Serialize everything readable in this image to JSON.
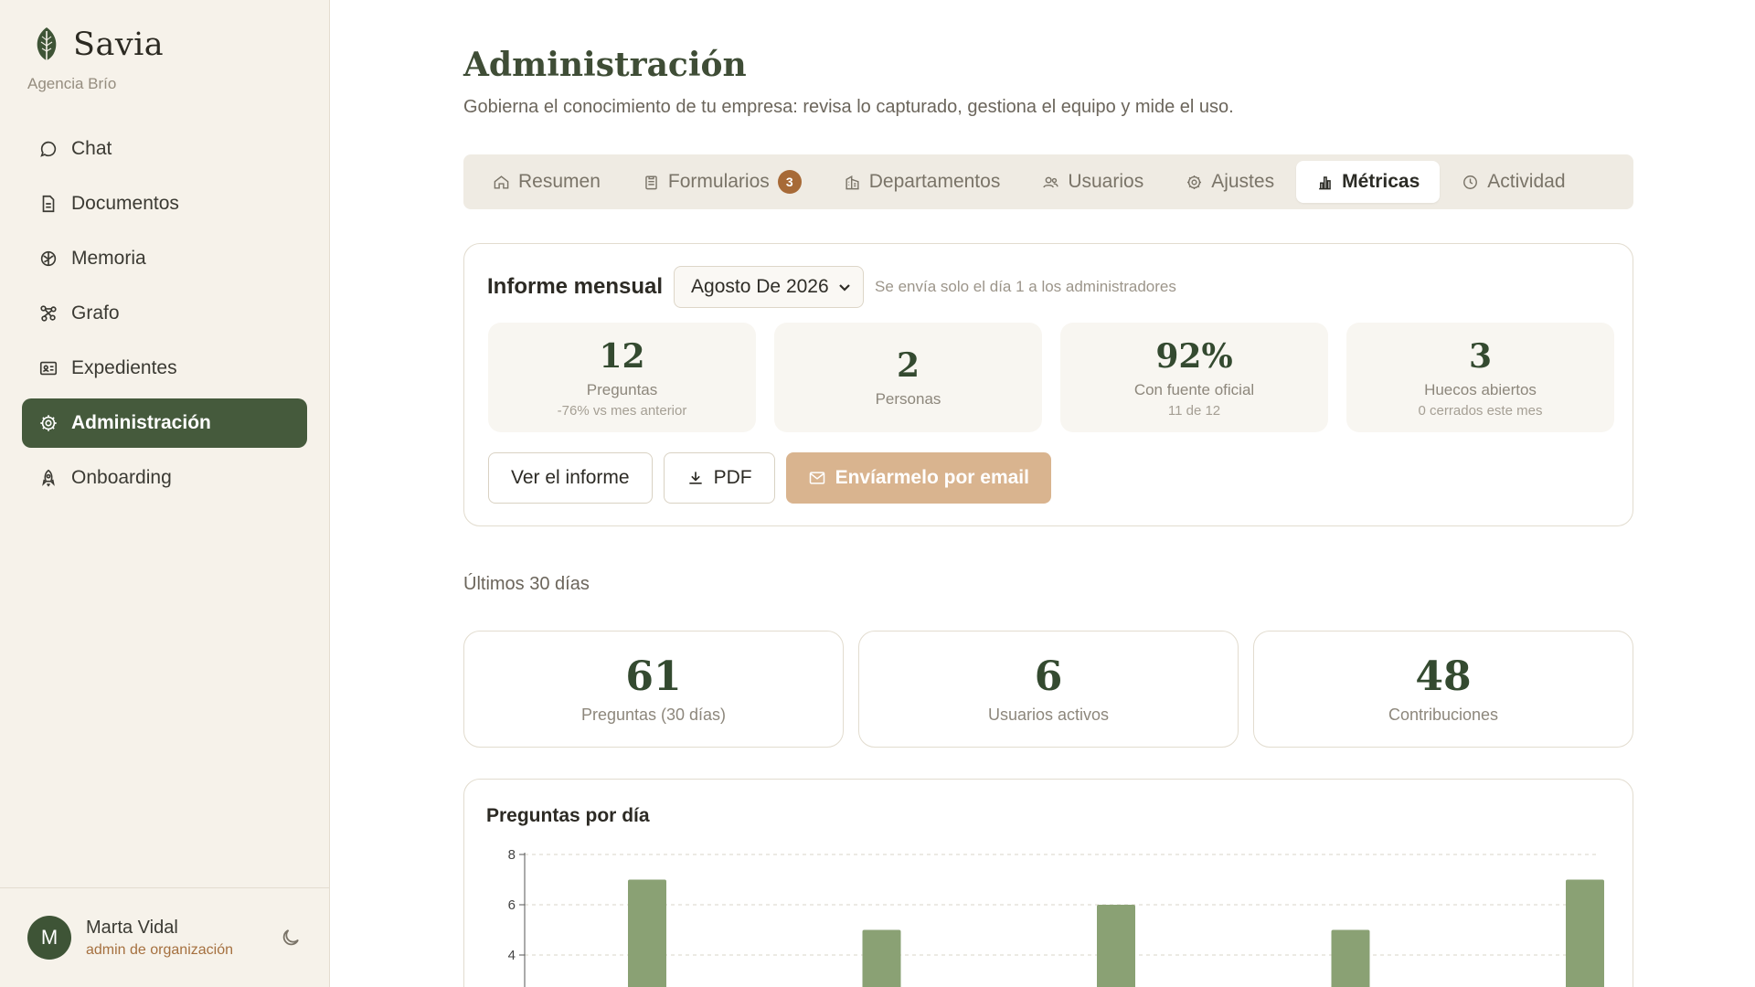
{
  "sidebar": {
    "brand": "Savia",
    "org": "Agencia Brío",
    "items": [
      {
        "label": "Chat",
        "icon": "chat-icon"
      },
      {
        "label": "Documentos",
        "icon": "document-icon"
      },
      {
        "label": "Memoria",
        "icon": "brain-icon"
      },
      {
        "label": "Grafo",
        "icon": "graph-icon"
      },
      {
        "label": "Expedientes",
        "icon": "id-card-icon"
      },
      {
        "label": "Administración",
        "icon": "gear-icon",
        "active": true
      },
      {
        "label": "Onboarding",
        "icon": "rocket-icon"
      }
    ],
    "user": {
      "initial": "M",
      "name": "Marta Vidal",
      "role": "admin de organización"
    }
  },
  "header": {
    "title": "Administración",
    "subtitle": "Gobierna el conocimiento de tu empresa: revisa lo capturado, gestiona el equipo y mide el uso."
  },
  "tabs": [
    {
      "label": "Resumen",
      "icon": "home-icon"
    },
    {
      "label": "Formularios",
      "icon": "clipboard-icon",
      "badge": "3"
    },
    {
      "label": "Departamentos",
      "icon": "building-icon"
    },
    {
      "label": "Usuarios",
      "icon": "users-icon"
    },
    {
      "label": "Ajustes",
      "icon": "gear-icon"
    },
    {
      "label": "Métricas",
      "icon": "bar-chart-icon",
      "active": true
    },
    {
      "label": "Actividad",
      "icon": "clock-icon"
    }
  ],
  "report": {
    "title": "Informe mensual",
    "month": "Agosto De 2026",
    "note": "Se envía solo el día 1 a los administradores",
    "stats": [
      {
        "value": "12",
        "label": "Preguntas",
        "sub": "-76% vs mes anterior"
      },
      {
        "value": "2",
        "label": "Personas",
        "sub": ""
      },
      {
        "value": "92%",
        "label": "Con fuente oficial",
        "sub": "11 de 12"
      },
      {
        "value": "3",
        "label": "Huecos abiertos",
        "sub": "0 cerrados este mes"
      }
    ],
    "view_label": "Ver el informe",
    "pdf_label": "PDF",
    "email_label": "Envíarmelo por email"
  },
  "period": {
    "label": "Últimos 30 días",
    "kpis": [
      {
        "value": "61",
        "label": "Preguntas (30 días)"
      },
      {
        "value": "6",
        "label": "Usuarios activos"
      },
      {
        "value": "48",
        "label": "Contribuciones"
      }
    ]
  },
  "colors": {
    "accent": "#455a3c",
    "bar": "#8aa174",
    "badge": "#a76a37",
    "email_button": "#d9b48f"
  },
  "chart_data": {
    "type": "bar",
    "title": "Preguntas por día",
    "yticks": [
      4,
      6,
      8
    ],
    "ylim": [
      0,
      8
    ],
    "grid": true,
    "values": [
      7,
      5,
      6,
      5,
      7
    ]
  }
}
